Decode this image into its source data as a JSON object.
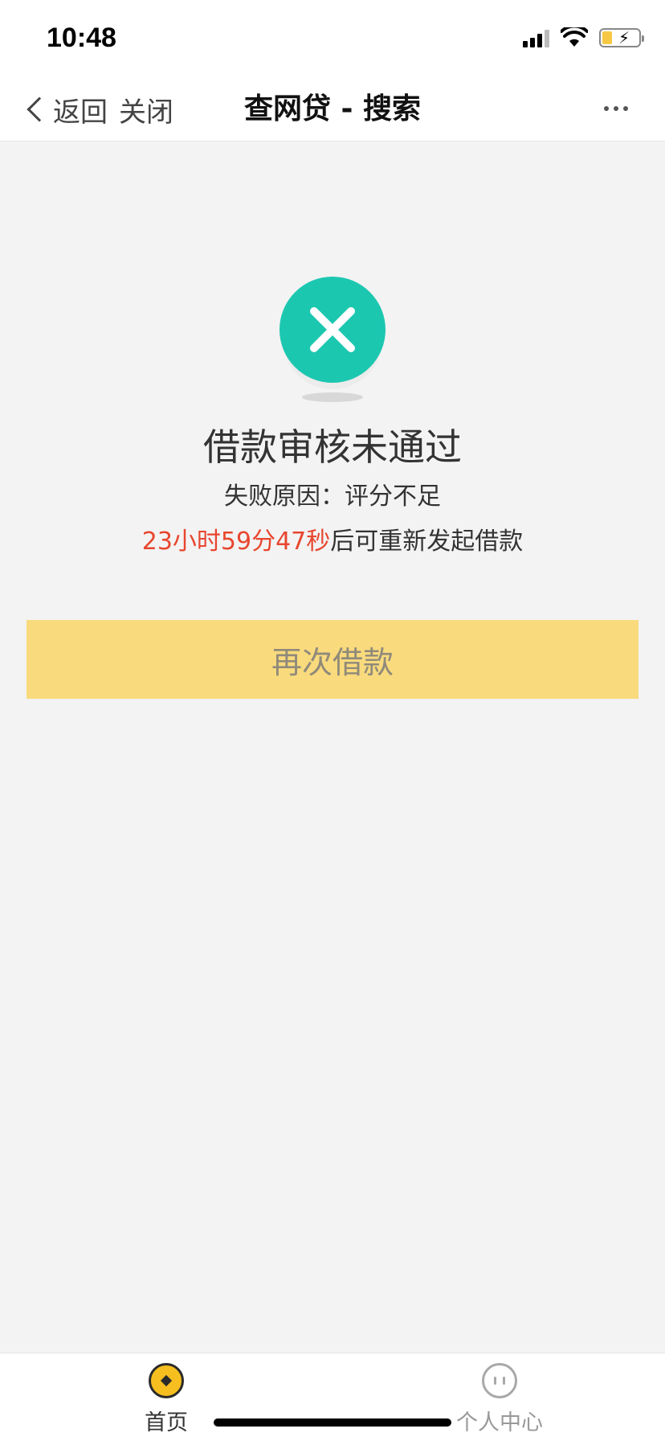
{
  "status_bar": {
    "time": "10:48"
  },
  "nav": {
    "back_label": "返回",
    "close_label": "关闭",
    "title": "查网贷 - 搜索"
  },
  "result": {
    "title": "借款审核未通过",
    "reason": "失败原因：评分不足",
    "countdown": "23小时59分47秒",
    "retry_suffix": "后可重新发起借款",
    "icon": "close-icon",
    "icon_color": "#1cc7b0"
  },
  "retry_button": {
    "label": "再次借款",
    "color": "#f9da7d"
  },
  "tab_bar": {
    "items": [
      {
        "label": "首页",
        "icon": "home-coin-icon",
        "active": true
      },
      {
        "label": "个人中心",
        "icon": "user-face-icon",
        "active": false
      }
    ]
  },
  "colors": {
    "accent": "#f6bf1f",
    "countdown": "#e8462e",
    "background": "#f3f3f3"
  }
}
